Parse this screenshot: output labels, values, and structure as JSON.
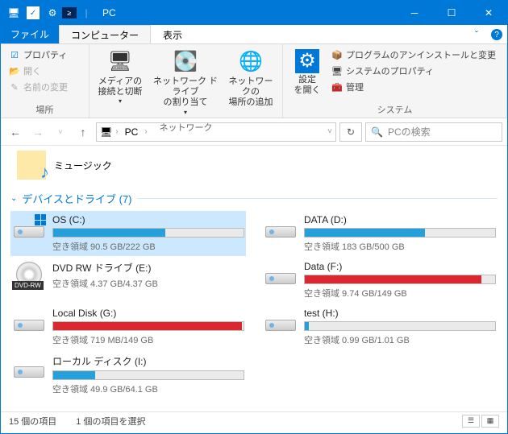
{
  "title": "PC",
  "tabs": {
    "file": "ファイル",
    "computer": "コンピューター",
    "view": "表示"
  },
  "ribbon": {
    "location": {
      "name": "場所",
      "props": "プロパティ",
      "open": "開く",
      "rename": "名前の変更"
    },
    "network": {
      "name": "ネットワーク",
      "media": "メディアの\n接続と切断",
      "map": "ネットワーク ドライブ\nの割り当て",
      "add": "ネットワークの\n場所の追加"
    },
    "system": {
      "name": "システム",
      "settings": "設定\nを開く",
      "uninstall": "プログラムのアンインストールと変更",
      "sysprops": "システムのプロパティ",
      "manage": "管理"
    }
  },
  "address": {
    "root": "PC"
  },
  "search": {
    "placeholder": "PCの検索"
  },
  "music": "ミュージック",
  "section": "デバイスとドライブ (7)",
  "drives": [
    {
      "name": "OS (C:)",
      "free": "空き領域 90.5 GB/222 GB",
      "pct": 59,
      "color": "blue",
      "type": "hdd",
      "sel": true,
      "win": true
    },
    {
      "name": "DATA (D:)",
      "free": "空き領域 183 GB/500 GB",
      "pct": 63,
      "color": "blue",
      "type": "hdd"
    },
    {
      "name": "DVD RW ドライブ (E:)",
      "free": "空き領域 4.37 GB/4.37 GB",
      "pct": 0,
      "color": "none",
      "type": "dvd"
    },
    {
      "name": "Data (F:)",
      "free": "空き領域 9.74 GB/149 GB",
      "pct": 93,
      "color": "red",
      "type": "hdd"
    },
    {
      "name": "Local Disk (G:)",
      "free": "空き領域 719 MB/149 GB",
      "pct": 99,
      "color": "red",
      "type": "hdd"
    },
    {
      "name": "test (H:)",
      "free": "空き領域 0.99 GB/1.01 GB",
      "pct": 2,
      "color": "blue",
      "type": "hdd"
    },
    {
      "name": "ローカル ディスク (I:)",
      "free": "空き領域 49.9 GB/64.1 GB",
      "pct": 22,
      "color": "blue",
      "type": "hdd"
    }
  ],
  "status": {
    "items": "15 個の項目",
    "selected": "1 個の項目を選択"
  }
}
